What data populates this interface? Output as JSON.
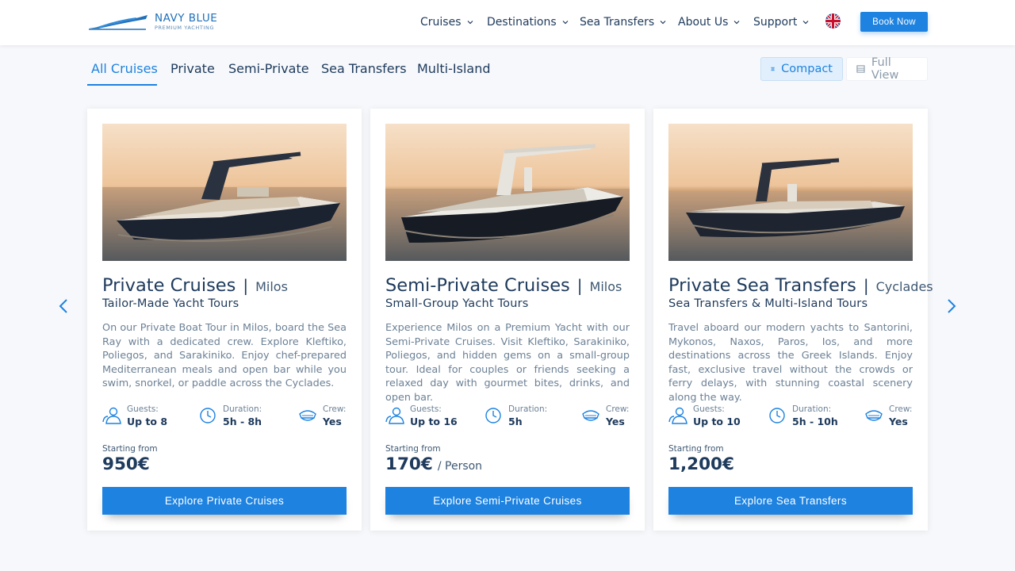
{
  "brand": {
    "name": "NAVY BLUE",
    "tagline": "PREMIUM YACHTING"
  },
  "nav": {
    "items": [
      {
        "label": "Cruises"
      },
      {
        "label": "Destinations"
      },
      {
        "label": "Sea Transfers"
      },
      {
        "label": "About Us"
      },
      {
        "label": "Support"
      }
    ],
    "language_icon": "uk-flag-icon",
    "book_now": "Book Now"
  },
  "tabs": [
    {
      "label": "All Cruises",
      "active": true
    },
    {
      "label": "Private"
    },
    {
      "label": "Semi-Private"
    },
    {
      "label": "Sea Transfers"
    },
    {
      "label": "Multi-Island"
    }
  ],
  "view_toggle": {
    "compact": "Compact",
    "full": "Full View",
    "selected": "Compact"
  },
  "colors": {
    "accent": "#1d82e0",
    "heading": "#1e3a5c",
    "body": "#6c8196"
  },
  "cards": [
    {
      "title": "Private Cruises",
      "location": "Milos",
      "subtitle": "Tailor-Made Yacht Tours",
      "description": "On our Private Boat Tour in Milos, board the Sea Ray with a dedicated crew. Explore Kleftiko, Poliegos, and Sarakiniko. Enjoy chef-prepared Mediterranean meals and open bar while you swim, snorkel, or paddle across the Cyclades.",
      "guests_label": "Guests:",
      "guests": "Up to 8",
      "duration_label": "Duration:",
      "duration": "5h - 8h",
      "crew_label": "Crew:",
      "crew": "Yes",
      "starting_label": "Starting from",
      "price": "950€",
      "price_unit": "",
      "button": "Explore Private Cruises"
    },
    {
      "title": "Semi-Private Cruises",
      "location": "Milos",
      "subtitle": "Small-Group Yacht Tours",
      "description": "Experience Milos on a Premium Yacht with our Semi-Private Cruises. Visit Kleftiko, Sarakiniko, Poliegos, and hidden gems on a small-group tour. Ideal for couples or friends seeking a relaxed day with gourmet bites, drinks, and open bar.",
      "guests_label": "Guests:",
      "guests": "Up to 16",
      "duration_label": "Duration:",
      "duration": "5h",
      "crew_label": "Crew:",
      "crew": "Yes",
      "starting_label": "Starting from",
      "price": "170€",
      "price_unit": "/ Person",
      "button": "Explore Semi-Private Cruises"
    },
    {
      "title": "Private Sea Transfers",
      "location": "Cyclades",
      "subtitle": "Sea Transfers & Multi-Island Tours",
      "description": "Travel aboard our modern yachts to Santorini, Mykonos, Naxos, Paros, Ios, and more destinations across the Greek Islands. Enjoy fast, exclusive travel without the crowds or ferry delays, with stunning coastal scenery along the way.",
      "guests_label": "Guests:",
      "guests": "Up to 10",
      "duration_label": "Duration:",
      "duration": "5h - 10h",
      "crew_label": "Crew:",
      "crew": "Yes",
      "starting_label": "Starting from",
      "price": "1,200€",
      "price_unit": "",
      "button": "Explore Sea Transfers"
    }
  ]
}
